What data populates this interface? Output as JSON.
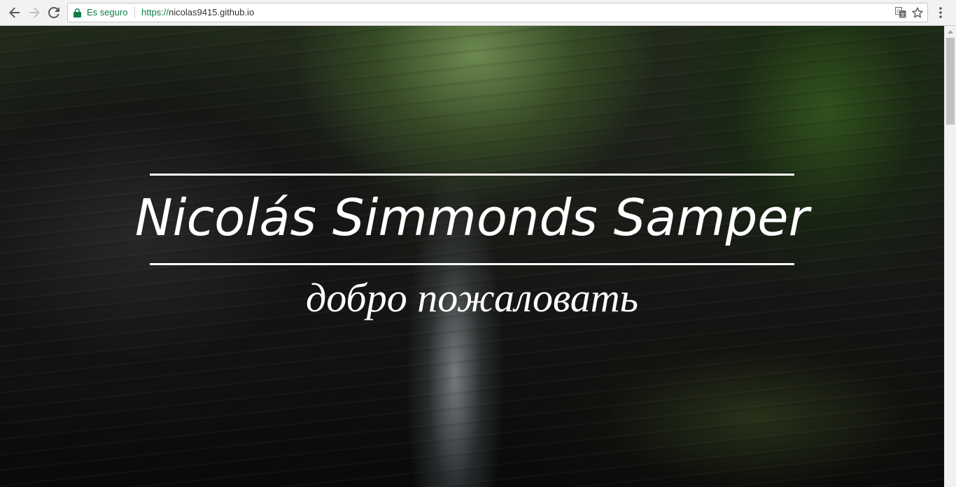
{
  "browser": {
    "security_label": "Es seguro",
    "url_scheme": "https://",
    "url_host": "nicolas9415.github.io",
    "icons": {
      "back": "back-arrow-icon",
      "forward": "forward-arrow-icon",
      "reload": "reload-icon",
      "lock": "lock-icon",
      "translate": "translate-icon",
      "bookmark": "star-icon",
      "menu": "kebab-menu-icon"
    },
    "colors": {
      "secure": "#0b8043",
      "toolbar_bg": "#f2f2f2"
    }
  },
  "hero": {
    "name": "Nicolás Simmonds Samper",
    "greeting": "добро пожаловать",
    "text_color": "#ffffff"
  }
}
